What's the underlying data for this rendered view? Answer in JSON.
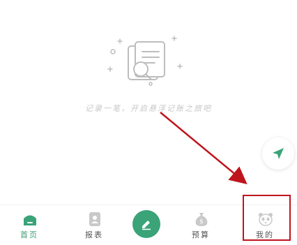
{
  "empty_state": {
    "message": "记录一笔，开启悬浮记账之旅吧"
  },
  "tabbar": {
    "tabs": [
      {
        "label": "首页",
        "icon": "home-icon",
        "active": true
      },
      {
        "label": "报表",
        "icon": "report-icon",
        "active": false
      },
      {
        "label": "",
        "icon": "pencil-icon",
        "active": false
      },
      {
        "label": "预算",
        "icon": "budget-icon",
        "active": false
      },
      {
        "label": "我的",
        "icon": "panda-icon",
        "active": false
      }
    ]
  },
  "colors": {
    "accent": "#3aa378",
    "annotation": "#c0141c",
    "muted": "#c7c7c7"
  }
}
